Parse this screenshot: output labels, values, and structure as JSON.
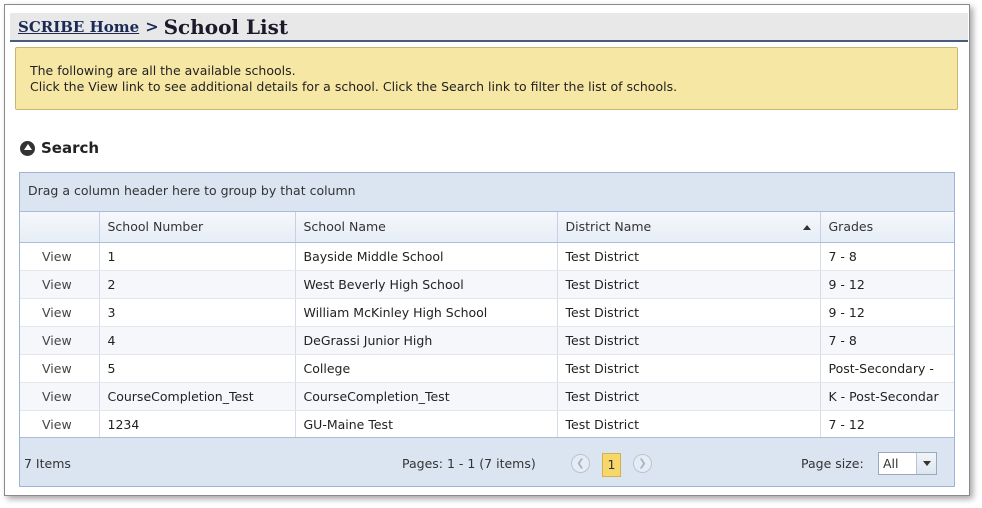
{
  "breadcrumb": {
    "home": "SCRIBE Home",
    "separator": ">",
    "current": "School List"
  },
  "info": {
    "line1": "The following are all the available schools.",
    "line2": "Click the View link to see additional details for a school. Click the Search link to filter the list of schools."
  },
  "search": {
    "label": "Search"
  },
  "grid": {
    "group_hint": "Drag a column header here to group by that column",
    "columns": [
      "",
      "School Number",
      "School Name",
      "District Name",
      "Grades"
    ],
    "sorted_column": "District Name",
    "sort_direction": "ascending",
    "rows": [
      {
        "action": "View",
        "number": "1",
        "name": "Bayside Middle School",
        "district": "Test District",
        "grades": "7 - 8"
      },
      {
        "action": "View",
        "number": "2",
        "name": "West Beverly High School",
        "district": "Test District",
        "grades": "9 - 12"
      },
      {
        "action": "View",
        "number": "3",
        "name": "William McKinley High School",
        "district": "Test District",
        "grades": "9 - 12"
      },
      {
        "action": "View",
        "number": "4",
        "name": "DeGrassi Junior High",
        "district": "Test District",
        "grades": "7 - 8"
      },
      {
        "action": "View",
        "number": "5",
        "name": "College",
        "district": "Test District",
        "grades": "Post-Secondary - "
      },
      {
        "action": "View",
        "number": "CourseCompletion_Test",
        "name": "CourseCompletion_Test",
        "district": "Test District",
        "grades": "K - Post-Secondar"
      },
      {
        "action": "View",
        "number": "1234",
        "name": "GU-Maine Test",
        "district": "Test District",
        "grades": "7 - 12"
      }
    ]
  },
  "pager": {
    "items_count": "7 Items",
    "pages_text": "Pages: 1 - 1 (7 items)",
    "current_page": "1",
    "page_size_label": "Page size:",
    "page_size_value": "All"
  },
  "colors": {
    "title_underline": "#4a5a80",
    "info_bg": "#f7e7a5",
    "grid_header_bg": "#dbe5f1",
    "current_page_bg": "#f7d66a"
  }
}
